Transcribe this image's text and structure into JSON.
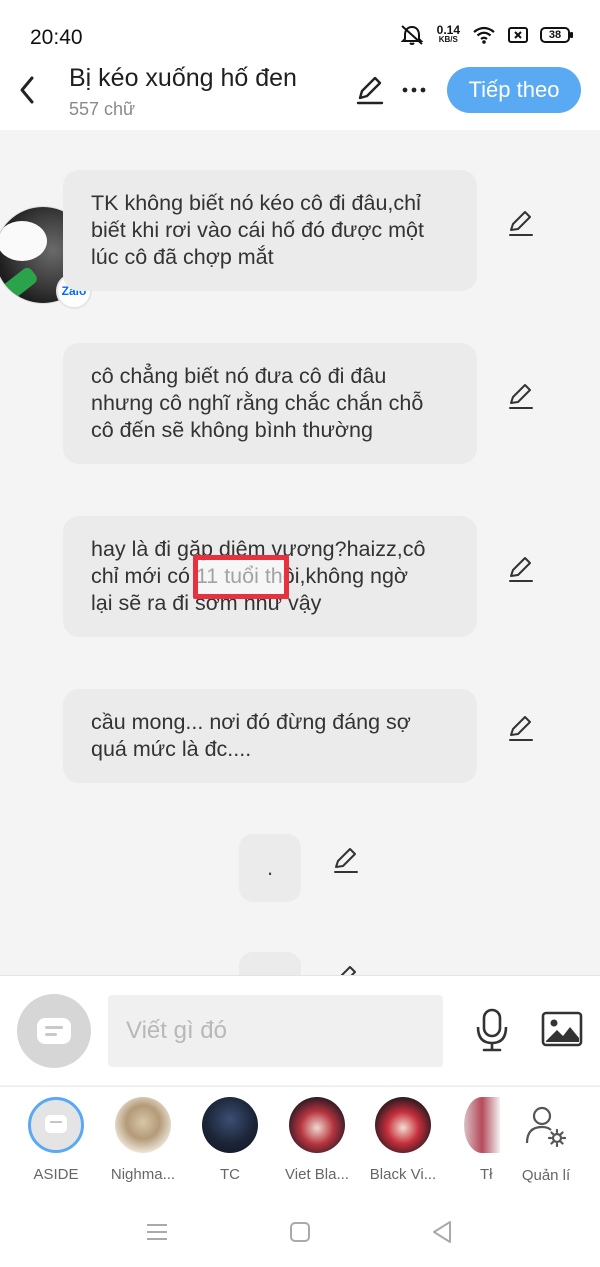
{
  "status": {
    "time": "20:40",
    "net_speed_value": "0.14",
    "net_speed_unit": "KB/S",
    "battery": "38"
  },
  "header": {
    "title": "Bị kéo xuống hố đen",
    "word_count": "557 chữ",
    "next_label": "Tiếp theo"
  },
  "messages": [
    {
      "text": "TK không biết nó kéo cô đi đâu,chỉ\nbiết khi rơi vào cái hố đó được một\nlúc cô đã chợp mắt"
    },
    {
      "text": "cô chẳng biết nó đưa cô đi đâu\nnhưng cô nghĩ rằng chắc chắn chỗ\ncô đến sẽ không bình thường"
    },
    {
      "text": "hay là đi gặp diêm vương?haizz,cô\nchỉ mới có 11 tuổi thôi,không ngờ\nlại sẽ ra đi sớm như vậy"
    },
    {
      "text": "cầu mong... nơi đó đừng đáng sợ\nquá mức là đc...."
    },
    {
      "text": "."
    }
  ],
  "avatar_badge": "Zalo",
  "highlight_text": "11 tuổi",
  "composer": {
    "placeholder": "Viết gì đó"
  },
  "characters": [
    {
      "name": "ASIDE"
    },
    {
      "name": "Nighma..."
    },
    {
      "name": "TC"
    },
    {
      "name": "Viet Bla..."
    },
    {
      "name": "Black Vi..."
    },
    {
      "name": "Tł"
    },
    {
      "name": "Quản lí"
    }
  ],
  "colors": {
    "accent": "#5aa9f3",
    "highlight": "#e8313f",
    "bubble": "#ebebeb"
  }
}
